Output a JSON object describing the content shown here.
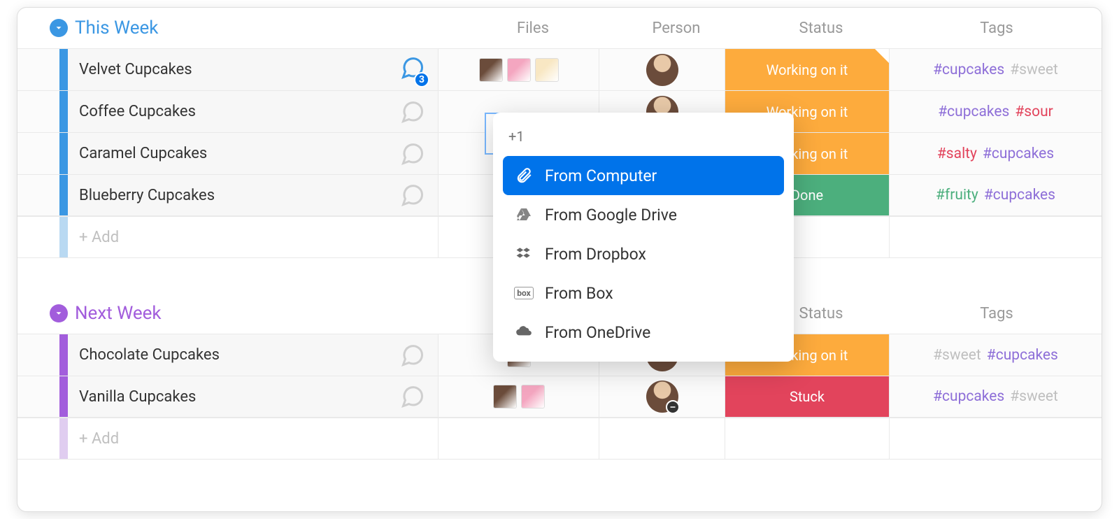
{
  "columns": {
    "files": "Files",
    "person": "Person",
    "status": "Status",
    "tags": "Tags"
  },
  "statusColors": {
    "Working on it": "#fdab3d",
    "Done": "#4caf7d",
    "Stuck": "#e2445c"
  },
  "tagPalette": {
    "cupcakes": "#8e6fd8",
    "sweet": "#bfbfbf",
    "sour": "#e2445c",
    "salty": "#e2445c",
    "fruity": "#4caf7d"
  },
  "groups": [
    {
      "title": "This Week",
      "color": "#3b97e3",
      "rows": [
        {
          "name": "Velvet Cupcakes",
          "chatCount": 3,
          "files": 3,
          "status": "Working on it",
          "statusFold": true,
          "tags": [
            "cupcakes",
            "sweet"
          ]
        },
        {
          "name": "Coffee Cupcakes",
          "chatCount": 0,
          "files": 0,
          "status": "Working on it",
          "statusFold": false,
          "tags": [
            "cupcakes",
            "sour"
          ]
        },
        {
          "name": "Caramel Cupcakes",
          "chatCount": 0,
          "files": 0,
          "status": "Working on it",
          "statusFold": false,
          "tags": [
            "salty",
            "cupcakes"
          ]
        },
        {
          "name": "Blueberry Cupcakes",
          "chatCount": 0,
          "files": 0,
          "status": "Done",
          "statusFold": false,
          "tags": [
            "fruity",
            "cupcakes"
          ]
        }
      ],
      "addLabel": "+ Add"
    },
    {
      "title": "Next Week",
      "color": "#a25ddc",
      "rows": [
        {
          "name": "Chocolate Cupcakes",
          "chatCount": 0,
          "files": 1,
          "status": "Working on it",
          "statusFold": false,
          "tags": [
            "sweet",
            "cupcakes"
          ]
        },
        {
          "name": "Vanilla Cupcakes",
          "chatCount": 0,
          "files": 2,
          "avatarBadge": true,
          "status": "Stuck",
          "statusFold": false,
          "tags": [
            "cupcakes",
            "sweet"
          ]
        }
      ],
      "addLabel": "+ Add"
    }
  ],
  "popup": {
    "extra": "+1",
    "items": [
      {
        "label": "From Computer",
        "selected": true
      },
      {
        "label": "From Google Drive",
        "selected": false
      },
      {
        "label": "From Dropbox",
        "selected": false
      },
      {
        "label": "From Box",
        "selected": false
      },
      {
        "label": "From OneDrive",
        "selected": false
      }
    ]
  }
}
